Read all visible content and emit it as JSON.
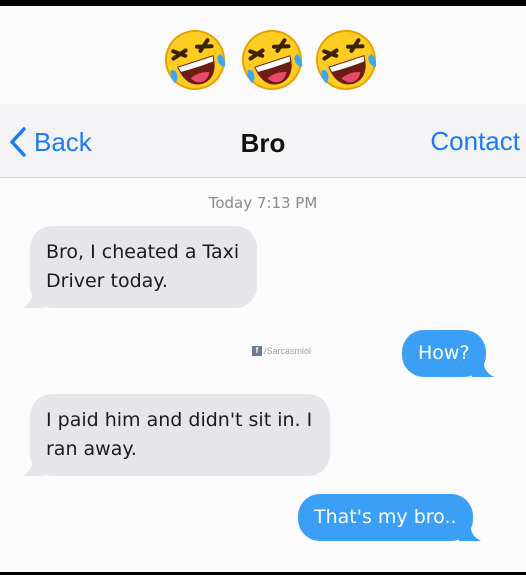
{
  "header": {
    "emojis": [
      "rolling-on-floor-laughing",
      "rolling-on-floor-laughing",
      "rolling-on-floor-laughing"
    ]
  },
  "nav": {
    "back_label": "Back",
    "title": "Bro",
    "contact_label": "Contact"
  },
  "conversation": {
    "timestamp": "Today 7:13 PM",
    "watermark": "/Sarcasmlol",
    "messages": [
      {
        "direction": "incoming",
        "lines": [
          "Bro, I cheated a Taxi",
          "Driver today."
        ]
      },
      {
        "direction": "outgoing",
        "text": "How?"
      },
      {
        "direction": "incoming",
        "lines": [
          "I paid him and didn't sit in. I",
          "ran away."
        ]
      },
      {
        "direction": "outgoing",
        "text": "That's my bro.."
      }
    ]
  },
  "colors": {
    "accent": "#1a7cf0",
    "outgoing_bubble": "#3a9ff5",
    "incoming_bubble": "#e5e5ea"
  }
}
